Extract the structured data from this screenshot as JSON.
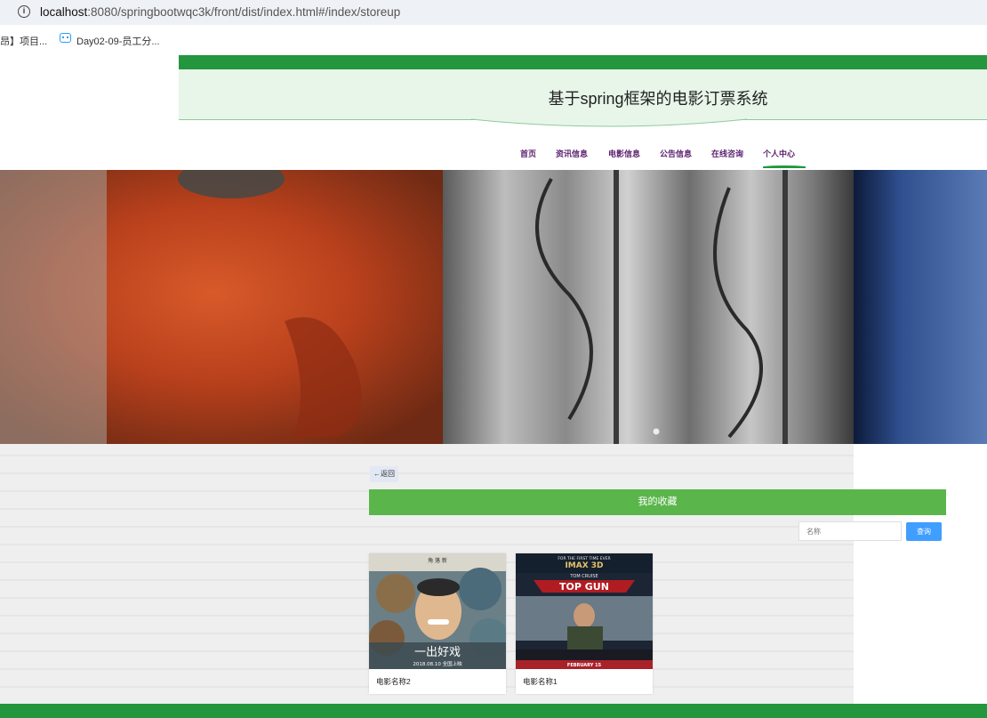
{
  "browser": {
    "url_host": "localhost",
    "url_rest": ":8080/springbootwqc3k/front/dist/index.html#/index/storeup",
    "bookmarks": [
      {
        "label": "昂】项目..."
      },
      {
        "label": "Day02-09-员工分..."
      }
    ]
  },
  "site": {
    "title": "基于spring框架的电影订票系统"
  },
  "nav": [
    {
      "label": "首页"
    },
    {
      "label": "资讯信息"
    },
    {
      "label": "电影信息"
    },
    {
      "label": "公告信息"
    },
    {
      "label": "在线咨询"
    },
    {
      "label": "个人中心",
      "active": true
    }
  ],
  "content": {
    "back_label": "←返回",
    "section_title": "我的收藏",
    "search": {
      "placeholder": "名称",
      "button_label": "查询"
    },
    "cards": [
      {
        "name": "电影名称2",
        "poster_text": {
          "top": "角 落 新",
          "bottom": "一出好戏",
          "date": "2018.08.10 全国上映"
        }
      },
      {
        "name": "电影名称1",
        "poster_text": {
          "top": "FOR THE FIRST TIME EVER",
          "imax": "IMAX 3D",
          "actor": "TOM CRUISE",
          "title": "TOP GUN",
          "date": "FEBRUARY 15"
        }
      }
    ]
  },
  "colors": {
    "brand_green": "#23963e",
    "section_green": "#5ab54a",
    "nav_text": "#5a1f6e",
    "button_blue": "#409eff"
  }
}
